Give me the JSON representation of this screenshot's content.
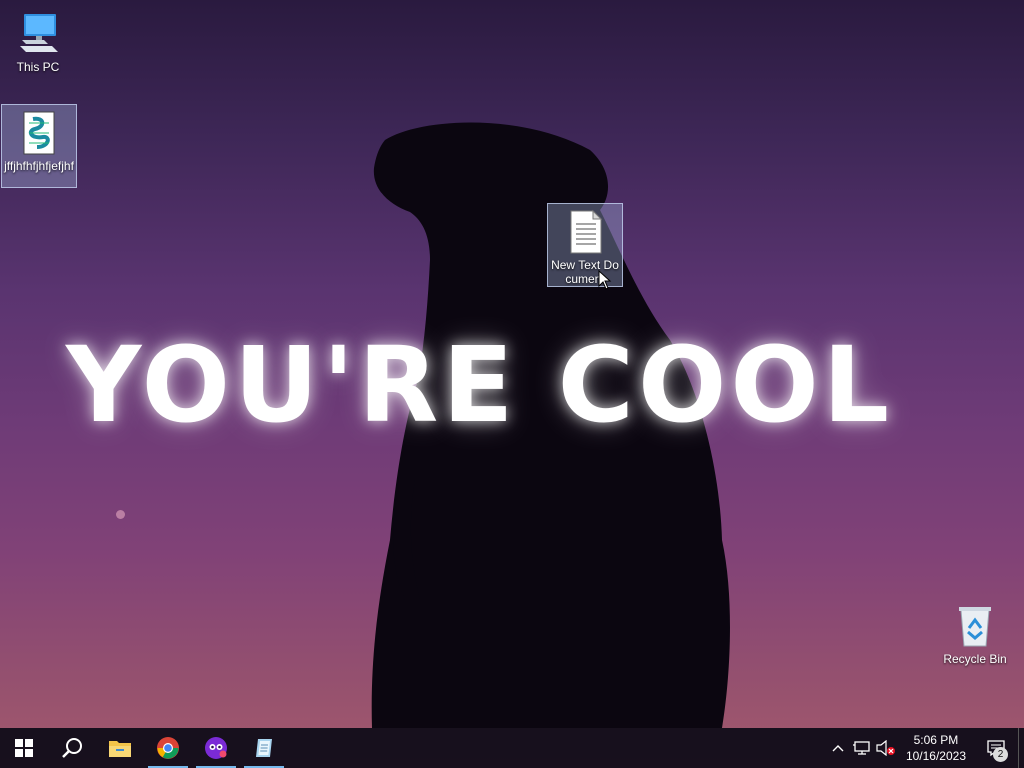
{
  "wallpaper": {
    "text": "YOU'RE COOL"
  },
  "desktop_icons": {
    "this_pc": {
      "label": "This PC"
    },
    "script_file": {
      "label": "jffjhfhfjhfjefjhf"
    },
    "text_document": {
      "label": "New Text Document"
    },
    "recycle_bin": {
      "label": "Recycle Bin"
    }
  },
  "taskbar": {
    "pinned": [
      {
        "name": "start-button-icon"
      },
      {
        "name": "search-icon"
      },
      {
        "name": "file-explorer-icon"
      },
      {
        "name": "chrome-icon"
      },
      {
        "name": "app-icon"
      },
      {
        "name": "notepad-icon"
      }
    ],
    "clock": {
      "time": "5:06 PM",
      "date": "10/16/2023"
    },
    "notifications": {
      "count": "2"
    }
  },
  "colors": {
    "taskbar_bg": "#120e1a",
    "running_indicator": "#76b9ed",
    "wall_text": "#ffffff"
  }
}
